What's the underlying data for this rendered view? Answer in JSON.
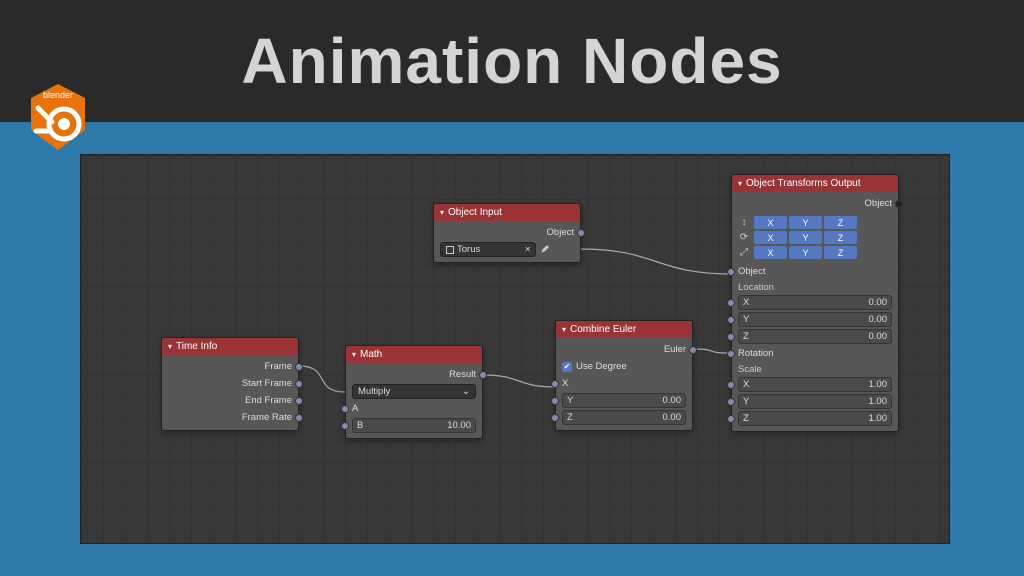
{
  "header": {
    "title": "Animation Nodes",
    "logo_text": "blender"
  },
  "nodes": {
    "time_info": {
      "title": "Time Info",
      "out": [
        "Frame",
        "Start Frame",
        "End Frame",
        "Frame Rate"
      ]
    },
    "math": {
      "title": "Math",
      "out_result": "Result",
      "op": "Multiply",
      "in_a": "A",
      "in_b": {
        "label": "B",
        "value": "10.00"
      }
    },
    "obj_input": {
      "title": "Object Input",
      "out_object": "Object",
      "field_label": "Torus"
    },
    "combine": {
      "title": "Combine Euler",
      "out_euler": "Euler",
      "use_degree": "Use Degree",
      "in_x": "X",
      "in_y": {
        "label": "Y",
        "value": "0.00"
      },
      "in_z": {
        "label": "Z",
        "value": "0.00"
      }
    },
    "obj_output": {
      "title": "Object Transforms Output",
      "out_object": "Object",
      "xyz": [
        "X",
        "Y",
        "Z"
      ],
      "in_object": "Object",
      "section_location": "Location",
      "loc": [
        {
          "label": "X",
          "value": "0.00"
        },
        {
          "label": "Y",
          "value": "0.00"
        },
        {
          "label": "Z",
          "value": "0.00"
        }
      ],
      "section_rotation": "Rotation",
      "section_scale": "Scale",
      "scale": [
        {
          "label": "X",
          "value": "1.00"
        },
        {
          "label": "Y",
          "value": "1.00"
        },
        {
          "label": "Z",
          "value": "1.00"
        }
      ]
    }
  }
}
